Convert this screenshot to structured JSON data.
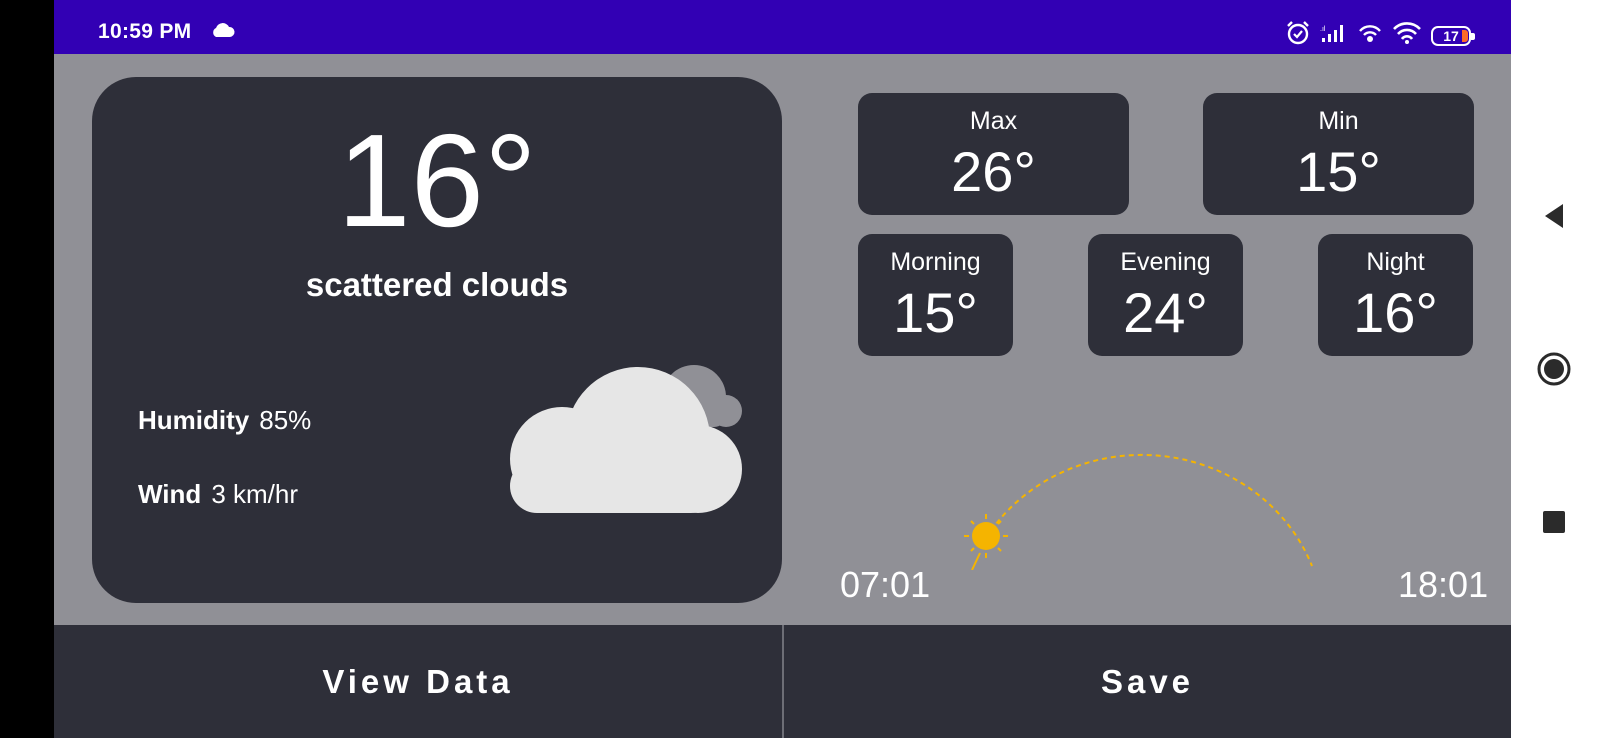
{
  "status_bar": {
    "time": "10:59 PM",
    "battery": "17",
    "icons": [
      "cloud-icon",
      "alarm-icon",
      "signal-icon",
      "hotspot-icon",
      "wifi-icon",
      "battery-icon"
    ],
    "background": "#3200b4"
  },
  "current": {
    "temperature": "16°",
    "description": "scattered clouds",
    "humidity_label": "Humidity",
    "humidity_value": "85%",
    "wind_label": "Wind",
    "wind_value": "3 km/hr"
  },
  "tiles": {
    "max": {
      "label": "Max",
      "value": "26°"
    },
    "min": {
      "label": "Min",
      "value": "15°"
    },
    "morning": {
      "label": "Morning",
      "value": "15°"
    },
    "evening": {
      "label": "Evening",
      "value": "24°"
    },
    "night": {
      "label": "Night",
      "value": "16°"
    }
  },
  "sun": {
    "sunrise": "07:01",
    "sunset": "18:01",
    "sun_color": "#f5b400"
  },
  "buttons": {
    "view_data": "View Data",
    "save": "Save"
  },
  "colors": {
    "card": "#2e2f39",
    "background": "#909096"
  }
}
